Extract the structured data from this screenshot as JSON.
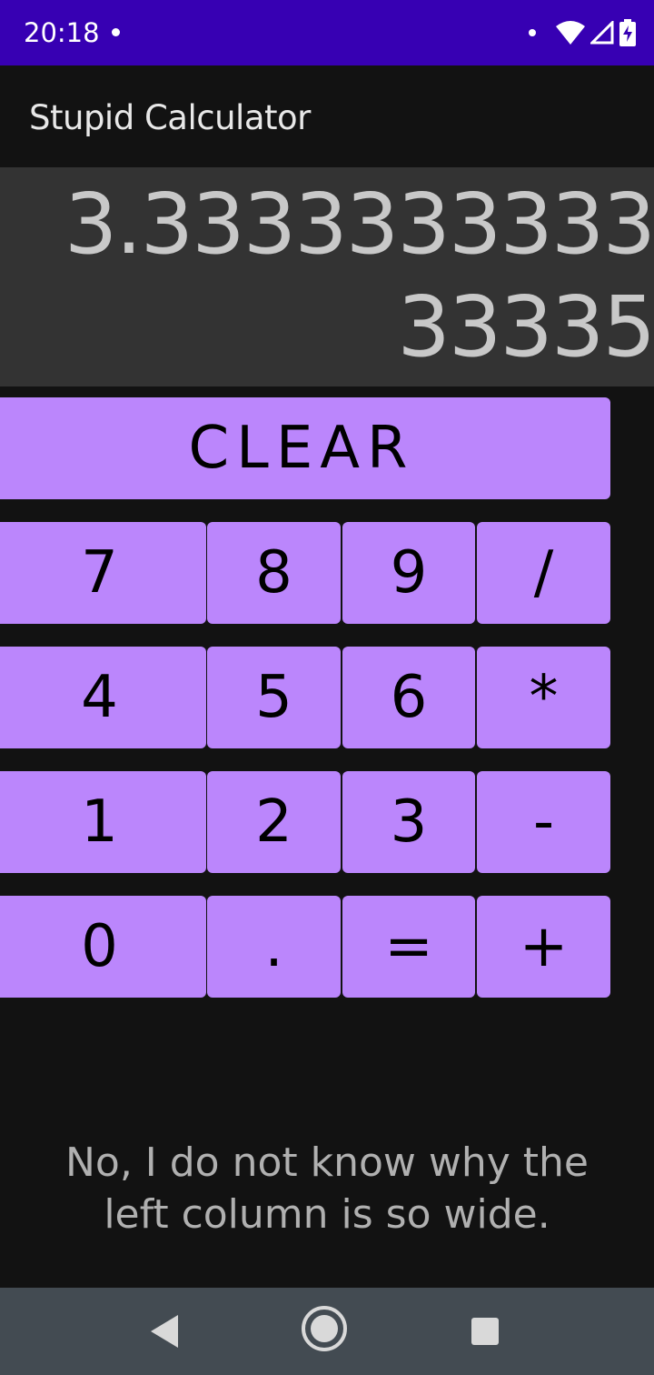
{
  "status_bar": {
    "time": "20:18",
    "background_color": "#3700b3",
    "icons": [
      "notification-dot-icon",
      "wifi-icon",
      "signal-icon",
      "battery-charging-icon"
    ]
  },
  "app_bar": {
    "title": "Stupid Calculator"
  },
  "display": {
    "value": "3.333333333333335"
  },
  "buttons": {
    "clear": "CLEAR",
    "rows": [
      [
        "7",
        "8",
        "9",
        "/"
      ],
      [
        "4",
        "5",
        "6",
        "*"
      ],
      [
        "1",
        "2",
        "3",
        "-"
      ],
      [
        "0",
        ".",
        "=",
        "+"
      ]
    ],
    "color": "#bb86fc"
  },
  "footer": {
    "note": "No, I do not know why the left column is so wide."
  },
  "nav_bar": {
    "icons": [
      "back-icon",
      "home-icon",
      "recents-icon"
    ]
  }
}
